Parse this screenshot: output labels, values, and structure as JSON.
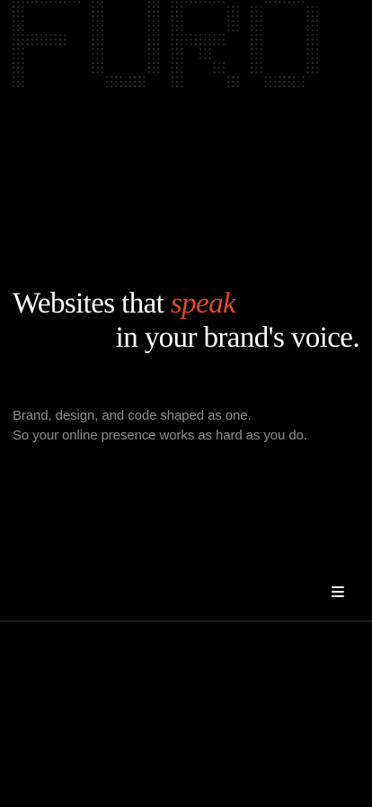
{
  "brand": {
    "logo_text": "FURO"
  },
  "hero": {
    "headline_part1": "Websites that ",
    "headline_accent": "speak",
    "headline_line2": "in your brand's voice.",
    "accent_color": "#e2462b"
  },
  "subtitle": {
    "line1": "Brand, design, and code shaped as one.",
    "line2": "So your online presence works as hard as you do."
  },
  "nav": {
    "menu_icon": "hamburger-menu-icon"
  }
}
